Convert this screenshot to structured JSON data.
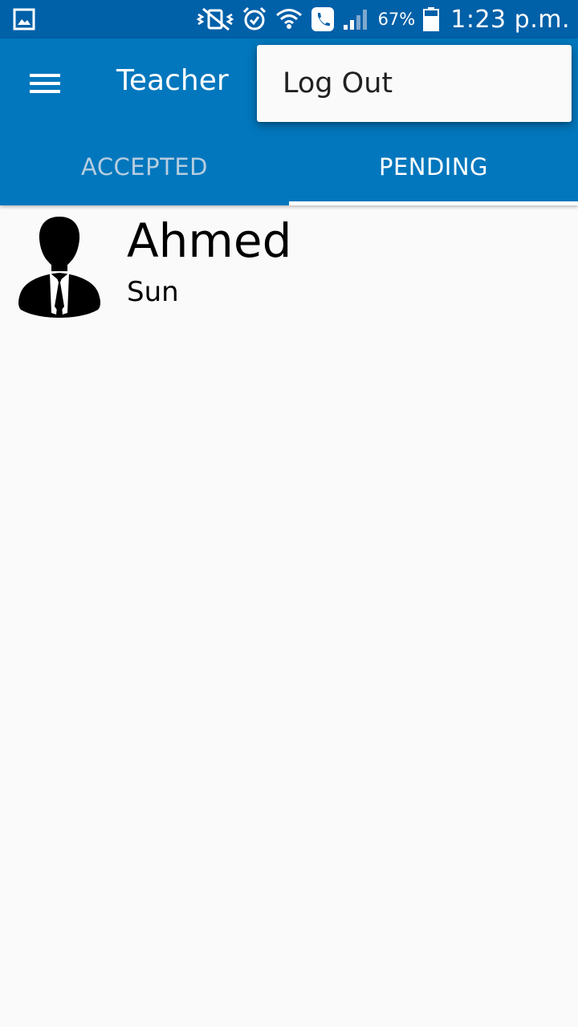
{
  "status_bar": {
    "battery": "67%",
    "time": "1:23 p.m.",
    "icons": [
      "gallery-icon",
      "vibrate-off-icon",
      "alarm-icon",
      "wifi-icon",
      "call-icon",
      "signal-icon",
      "battery-icon"
    ]
  },
  "toolbar": {
    "title": "Teacher",
    "menu_icon": "hamburger-menu-icon"
  },
  "tabs": [
    {
      "label": "ACCEPTED",
      "selected": false
    },
    {
      "label": "PENDING",
      "selected": true
    }
  ],
  "overflow_menu": {
    "items": [
      {
        "label": "Log Out"
      }
    ]
  },
  "list": {
    "items": [
      {
        "name": "Ahmed",
        "subtitle": "Sun",
        "avatar_icon": "person-avatar-icon"
      }
    ]
  },
  "colors": {
    "status_bar": "#0060a8",
    "app_bar": "#0277bd",
    "tab_inactive_text": "#b5cde0",
    "background": "#fafafa"
  }
}
